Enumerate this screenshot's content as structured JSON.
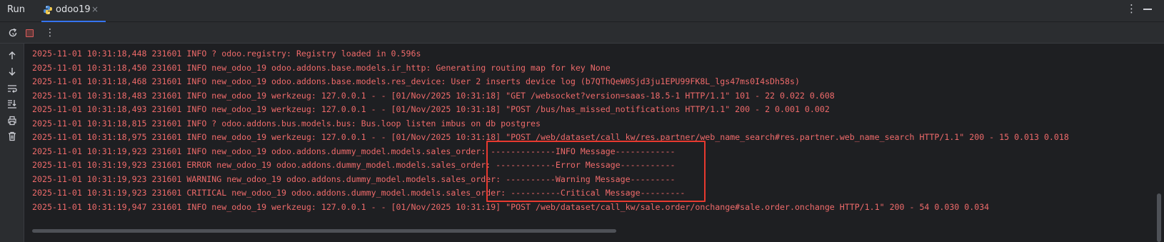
{
  "header": {
    "run_label": "Run",
    "tab_label": "odoo19",
    "close_glyph": "×",
    "more_glyph": "⋮"
  },
  "toolbar": {
    "items": [
      {
        "name": "rerun-icon"
      },
      {
        "name": "stop-icon"
      },
      {
        "name": "more-options-icon"
      }
    ]
  },
  "gutter": {
    "items": [
      {
        "name": "scroll-up-icon"
      },
      {
        "name": "scroll-down-icon"
      },
      {
        "name": "soft-wrap-icon"
      },
      {
        "name": "scroll-to-end-icon"
      },
      {
        "name": "print-icon"
      },
      {
        "name": "clear-all-icon"
      }
    ]
  },
  "colors": {
    "log_text": "#ee6a6a",
    "highlight": "#e8392f",
    "accent": "#3574f0"
  },
  "console": {
    "lines": [
      "2025-11-01 10:31:18,448 231601 INFO ? odoo.registry: Registry loaded in 0.596s",
      "2025-11-01 10:31:18,450 231601 INFO new_odoo_19 odoo.addons.base.models.ir_http: Generating routing map for key None",
      "2025-11-01 10:31:18,468 231601 INFO new_odoo_19 odoo.addons.base.models.res_device: User 2 inserts device log (b7QThQeW0Sjd3ju1EPU99FK8L_lgs47ms0I4sDh58s)",
      "2025-11-01 10:31:18,483 231601 INFO new_odoo_19 werkzeug: 127.0.0.1 - - [01/Nov/2025 10:31:18] \"GET /websocket?version=saas-18.5-1 HTTP/1.1\" 101 - 22 0.022 0.608",
      "2025-11-01 10:31:18,493 231601 INFO new_odoo_19 werkzeug: 127.0.0.1 - - [01/Nov/2025 10:31:18] \"POST /bus/has_missed_notifications HTTP/1.1\" 200 - 2 0.001 0.002",
      "2025-11-01 10:31:18,815 231601 INFO ? odoo.addons.bus.models.bus: Bus.loop listen imbus on db postgres",
      "2025-11-01 10:31:18,975 231601 INFO new_odoo_19 werkzeug: 127.0.0.1 - - [01/Nov/2025 10:31:18] \"POST /web/dataset/call_kw/res.partner/web_name_search#res.partner.web_name_search HTTP/1.1\" 200 - 15 0.013 0.018",
      "2025-11-01 10:31:19,923 231601 INFO new_odoo_19 odoo.addons.dummy_model.models.sales_order: -------------INFO Message------------",
      "2025-11-01 10:31:19,923 231601 ERROR new_odoo_19 odoo.addons.dummy_model.models.sales_order: ------------Error Message-----------",
      "2025-11-01 10:31:19,923 231601 WARNING new_odoo_19 odoo.addons.dummy_model.models.sales_order: ----------Warning Message---------",
      "2025-11-01 10:31:19,923 231601 CRITICAL new_odoo_19 odoo.addons.dummy_model.models.sales_order: ----------Critical Message---------",
      "2025-11-01 10:31:19,947 231601 INFO new_odoo_19 werkzeug: 127.0.0.1 - - [01/Nov/2025 10:31:19] \"POST /web/dataset/call_kw/sale.order/onchange#sale.order.onchange HTTP/1.1\" 200 - 54 0.030 0.034"
    ]
  }
}
